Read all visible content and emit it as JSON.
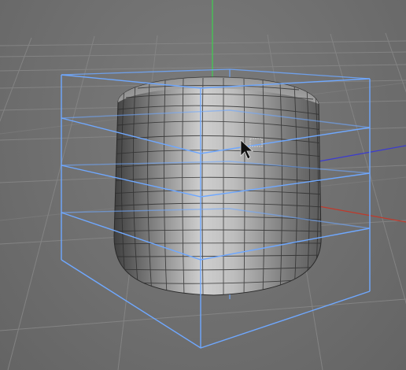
{
  "viewport": {
    "colors": {
      "background": "#6e6e6e",
      "grid_line": "#858585",
      "grid_line_major": "#9a9a9a",
      "axis_x": "#c0392b",
      "axis_y": "#2ecc40",
      "axis_z": "#3a3acb",
      "selection_cage": "#6fa8ff",
      "mesh_fill_light": "#cfcfcf",
      "mesh_fill_dark": "#4a4a4a",
      "mesh_wire": "#2b2b2b"
    },
    "object": {
      "name": "",
      "shape": "rounded-cube-subdivided",
      "cage_levels": 4
    },
    "cursor": {
      "type": "arrow-pointer-icon",
      "state": "hover"
    }
  }
}
